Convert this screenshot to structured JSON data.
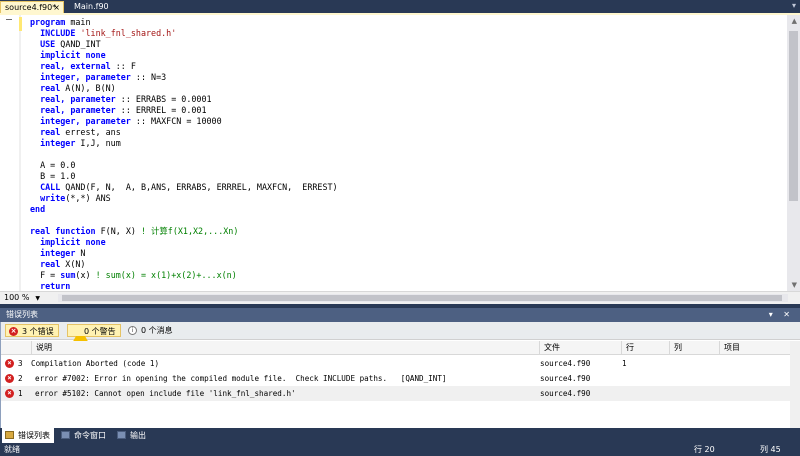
{
  "tabs": [
    {
      "label": "source4.f90*",
      "close": "×",
      "active": true
    },
    {
      "label": "Main.f90",
      "active": false
    }
  ],
  "tab_menu_icon": "▾",
  "editor": {
    "lines": [
      [
        {
          "t": "program",
          "k": "kw"
        },
        {
          "t": " main"
        }
      ],
      [
        {
          "t": "  "
        },
        {
          "t": "INCLUDE",
          "k": "kw"
        },
        {
          "t": " "
        },
        {
          "t": "'link_fnl_shared.h'",
          "k": "str"
        }
      ],
      [
        {
          "t": "  "
        },
        {
          "t": "USE",
          "k": "kw"
        },
        {
          "t": " QAND_INT"
        }
      ],
      [
        {
          "t": "  "
        },
        {
          "t": "implicit none",
          "k": "kw"
        }
      ],
      [
        {
          "t": "  "
        },
        {
          "t": "real, external",
          "k": "kw"
        },
        {
          "t": " :: F"
        }
      ],
      [
        {
          "t": "  "
        },
        {
          "t": "integer, parameter",
          "k": "kw"
        },
        {
          "t": " :: N=3"
        }
      ],
      [
        {
          "t": "  "
        },
        {
          "t": "real",
          "k": "kw"
        },
        {
          "t": " A(N), B(N)"
        }
      ],
      [
        {
          "t": "  "
        },
        {
          "t": "real, parameter",
          "k": "kw"
        },
        {
          "t": " :: ERRABS = 0.0001"
        }
      ],
      [
        {
          "t": "  "
        },
        {
          "t": "real, parameter",
          "k": "kw"
        },
        {
          "t": " :: ERRREL = 0.001"
        }
      ],
      [
        {
          "t": "  "
        },
        {
          "t": "integer, parameter",
          "k": "kw"
        },
        {
          "t": " :: MAXFCN = 10000"
        }
      ],
      [
        {
          "t": "  "
        },
        {
          "t": "real",
          "k": "kw"
        },
        {
          "t": " errest, ans"
        }
      ],
      [
        {
          "t": "  "
        },
        {
          "t": "integer",
          "k": "kw"
        },
        {
          "t": " I,J, num"
        }
      ],
      [
        {
          "t": ""
        }
      ],
      [
        {
          "t": "  A = 0.0"
        }
      ],
      [
        {
          "t": "  B = 1.0"
        }
      ],
      [
        {
          "t": "  "
        },
        {
          "t": "CALL",
          "k": "kw"
        },
        {
          "t": " QAND(F, N,  A, B,ANS, ERRABS, ERRREL, MAXFCN,  ERREST)"
        }
      ],
      [
        {
          "t": "  "
        },
        {
          "t": "write",
          "k": "kw"
        },
        {
          "t": "(*,*) ANS"
        }
      ],
      [
        {
          "t": "end",
          "k": "kw"
        }
      ],
      [
        {
          "t": ""
        }
      ],
      [
        {
          "t": "real function",
          "k": "kw"
        },
        {
          "t": " F(N, X) "
        },
        {
          "t": "! 计算f(X1,X2,...Xn)",
          "k": "cmt"
        }
      ],
      [
        {
          "t": "  "
        },
        {
          "t": "implicit none",
          "k": "kw"
        }
      ],
      [
        {
          "t": "  "
        },
        {
          "t": "integer",
          "k": "kw"
        },
        {
          "t": " N"
        }
      ],
      [
        {
          "t": "  "
        },
        {
          "t": "real",
          "k": "kw"
        },
        {
          "t": " X(N)"
        }
      ],
      [
        {
          "t": "  F = "
        },
        {
          "t": "sum",
          "k": "kw"
        },
        {
          "t": "(x) "
        },
        {
          "t": "! sum(x) = x(1)+x(2)+...x(n)",
          "k": "cmt"
        }
      ],
      [
        {
          "t": "  "
        },
        {
          "t": "return",
          "k": "kw"
        }
      ]
    ]
  },
  "zoom": {
    "label": "100 %",
    "arrow": "▼"
  },
  "error_list": {
    "title": "错误列表",
    "title_controls": "▾ ✕",
    "filters": {
      "errors": "3 个错误",
      "warnings": "0 个警告",
      "messages": "0 个消息"
    },
    "columns": {
      "description": "说明",
      "file": "文件",
      "line": "行",
      "column": "列",
      "project": "项目"
    },
    "rows": [
      {
        "num": "3",
        "description": "Compilation Aborted (code 1)",
        "file": "source4.f90",
        "line": "1",
        "column": "",
        "project": ""
      },
      {
        "num": "2",
        "description": "error #7002: Error in opening the compiled module file.  Check INCLUDE paths.   [QAND_INT]",
        "file": "source4.f90",
        "line": "",
        "column": "",
        "project": ""
      },
      {
        "num": "1",
        "description": "error #5102: Cannot open include file 'link_fnl_shared.h'",
        "file": "source4.f90",
        "line": "",
        "column": "",
        "project": ""
      }
    ]
  },
  "bottom_tabs": [
    "错误列表",
    "命令窗口",
    "输出"
  ],
  "status": {
    "ready": "就绪",
    "line": "行 20",
    "col": "列 45"
  },
  "colors": {
    "chrome": "#293955",
    "accent": "#fff7cf",
    "keyword": "#0000ff",
    "string": "#a31515",
    "comment": "#008000",
    "error": "#d22020"
  }
}
